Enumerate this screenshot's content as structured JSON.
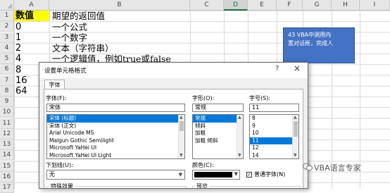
{
  "sheet": {
    "columns": [
      "A",
      "B",
      "C",
      "D",
      "E",
      "F",
      "G",
      "H",
      "I"
    ],
    "selected_column": "D",
    "rows": [
      "1",
      "2",
      "3",
      "4",
      "5",
      "6",
      "7",
      "8",
      "9",
      "10",
      "11",
      "12",
      "13",
      "14",
      "15",
      "16",
      "17"
    ],
    "cells": [
      {
        "a": "数值",
        "b": "期望的返回值"
      },
      {
        "a": "0",
        "b": "一个公式"
      },
      {
        "a": "1",
        "b": "一个数字"
      },
      {
        "a": "2",
        "b": "文本（字符串）"
      },
      {
        "a": "4",
        "b": "一个逻辑值，例如true或false"
      },
      {
        "a": "8",
        "b": ""
      },
      {
        "a": "16",
        "b": ""
      },
      {
        "a": "64",
        "b": ""
      }
    ]
  },
  "shape": {
    "text_line1": "43 VBA中调用内",
    "text_line2": "置对话框，完成人"
  },
  "dialog": {
    "title": "设置单元格格式",
    "help_label": "?",
    "close_label": "×",
    "tab_label": "字体",
    "font_label": "字体(F):",
    "font_value": "宋体",
    "font_list": [
      "宋体 (标题)",
      "宋体 (正文)",
      "Arial Unicode MS",
      "Malgun Gothic Semilight",
      "Microsoft YaHei UI",
      "Microsoft YaHei UI Light"
    ],
    "font_selected_index": 0,
    "style_label": "字形(O):",
    "style_value": "常规",
    "style_list": [
      "常规",
      "倾斜",
      "加粗",
      "加粗 倾斜"
    ],
    "style_selected_index": 0,
    "size_label": "字号(S):",
    "size_value": "11",
    "size_list": [
      "8",
      "9",
      "10",
      "11",
      "12",
      "14"
    ],
    "size_selected_index": 3,
    "underline_label": "下划线(U):",
    "underline_value": "无",
    "color_label": "颜色(C):",
    "color_value": "#000000",
    "normal_font_label": "普通字体(N)",
    "normal_font_checked": "✓",
    "effects_label": "特殊效果",
    "preview_label": "预览"
  },
  "watermark": {
    "text": "VBA语言专家"
  },
  "colors": {
    "header_yellow": "#ffff00",
    "shape_blue": "#4472c4",
    "selection_blue": "#0078d7"
  }
}
